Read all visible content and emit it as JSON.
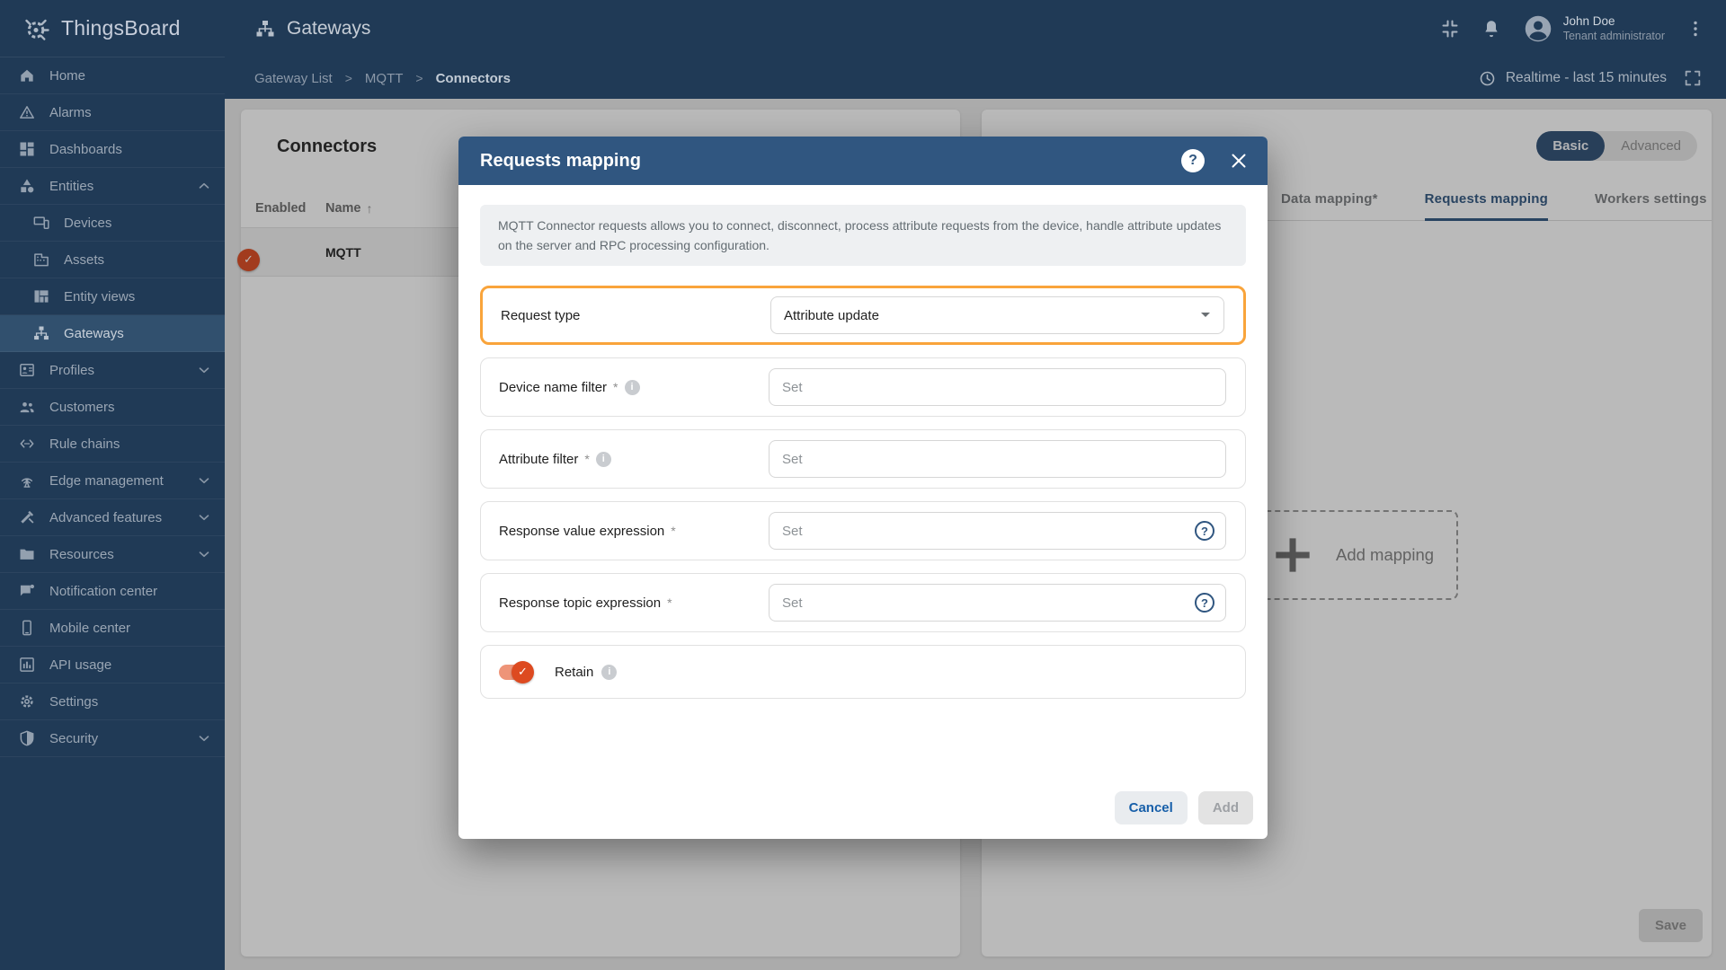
{
  "brand": {
    "name": "ThingsBoard"
  },
  "sidebar": {
    "items": [
      {
        "label": "Home"
      },
      {
        "label": "Alarms"
      },
      {
        "label": "Dashboards"
      },
      {
        "label": "Entities"
      },
      {
        "label": "Devices"
      },
      {
        "label": "Assets"
      },
      {
        "label": "Entity views"
      },
      {
        "label": "Gateways"
      },
      {
        "label": "Profiles"
      },
      {
        "label": "Customers"
      },
      {
        "label": "Rule chains"
      },
      {
        "label": "Edge management"
      },
      {
        "label": "Advanced features"
      },
      {
        "label": "Resources"
      },
      {
        "label": "Notification center"
      },
      {
        "label": "Mobile center"
      },
      {
        "label": "API usage"
      },
      {
        "label": "Settings"
      },
      {
        "label": "Security"
      }
    ]
  },
  "header": {
    "page_title": "Gateways",
    "realtime_label": "Realtime - last 15 minutes",
    "user": {
      "name": "John Doe",
      "role": "Tenant administrator"
    }
  },
  "breadcrumb": {
    "items": [
      "Gateway List",
      "MQTT",
      "Connectors"
    ],
    "separator": ">"
  },
  "connectors_panel": {
    "title": "Connectors",
    "columns": [
      "Enabled",
      "Name"
    ],
    "sort_indicator": "↑",
    "rows": [
      {
        "name": "MQTT",
        "enabled": true
      }
    ]
  },
  "config_panel": {
    "mode_options": [
      "Basic",
      "Advanced"
    ],
    "mode_selected": "Basic",
    "tabs": [
      "Data mapping*",
      "Requests mapping",
      "Workers settings"
    ],
    "active_tab": "Requests mapping",
    "add_mapping_label": "Add mapping",
    "save_label": "Save"
  },
  "dialog": {
    "title": "Requests mapping",
    "description": "MQTT Connector requests allows you to connect, disconnect, process attribute requests from the device, handle attribute updates on the server and RPC processing configuration.",
    "fields": [
      {
        "label": "Request type",
        "value": "Attribute update"
      },
      {
        "label": "Device name filter",
        "required": "*",
        "placeholder": "Set"
      },
      {
        "label": "Attribute filter",
        "required": "*",
        "placeholder": "Set"
      },
      {
        "label": "Response value expression",
        "required": "*",
        "placeholder": "Set"
      },
      {
        "label": "Response topic expression",
        "required": "*",
        "placeholder": "Set"
      }
    ],
    "retain_label": "Retain",
    "retain_enabled": true,
    "cancel_label": "Cancel",
    "add_label": "Add"
  },
  "icons": {
    "check": "✓",
    "question_mark": "?",
    "info": "i"
  },
  "colors": {
    "primary": "#305680",
    "sidebar": "#203a56",
    "toggle_orange": "#dd4a20",
    "toggle_track": "#ee9478",
    "highlight_border": "#f9a43b"
  }
}
